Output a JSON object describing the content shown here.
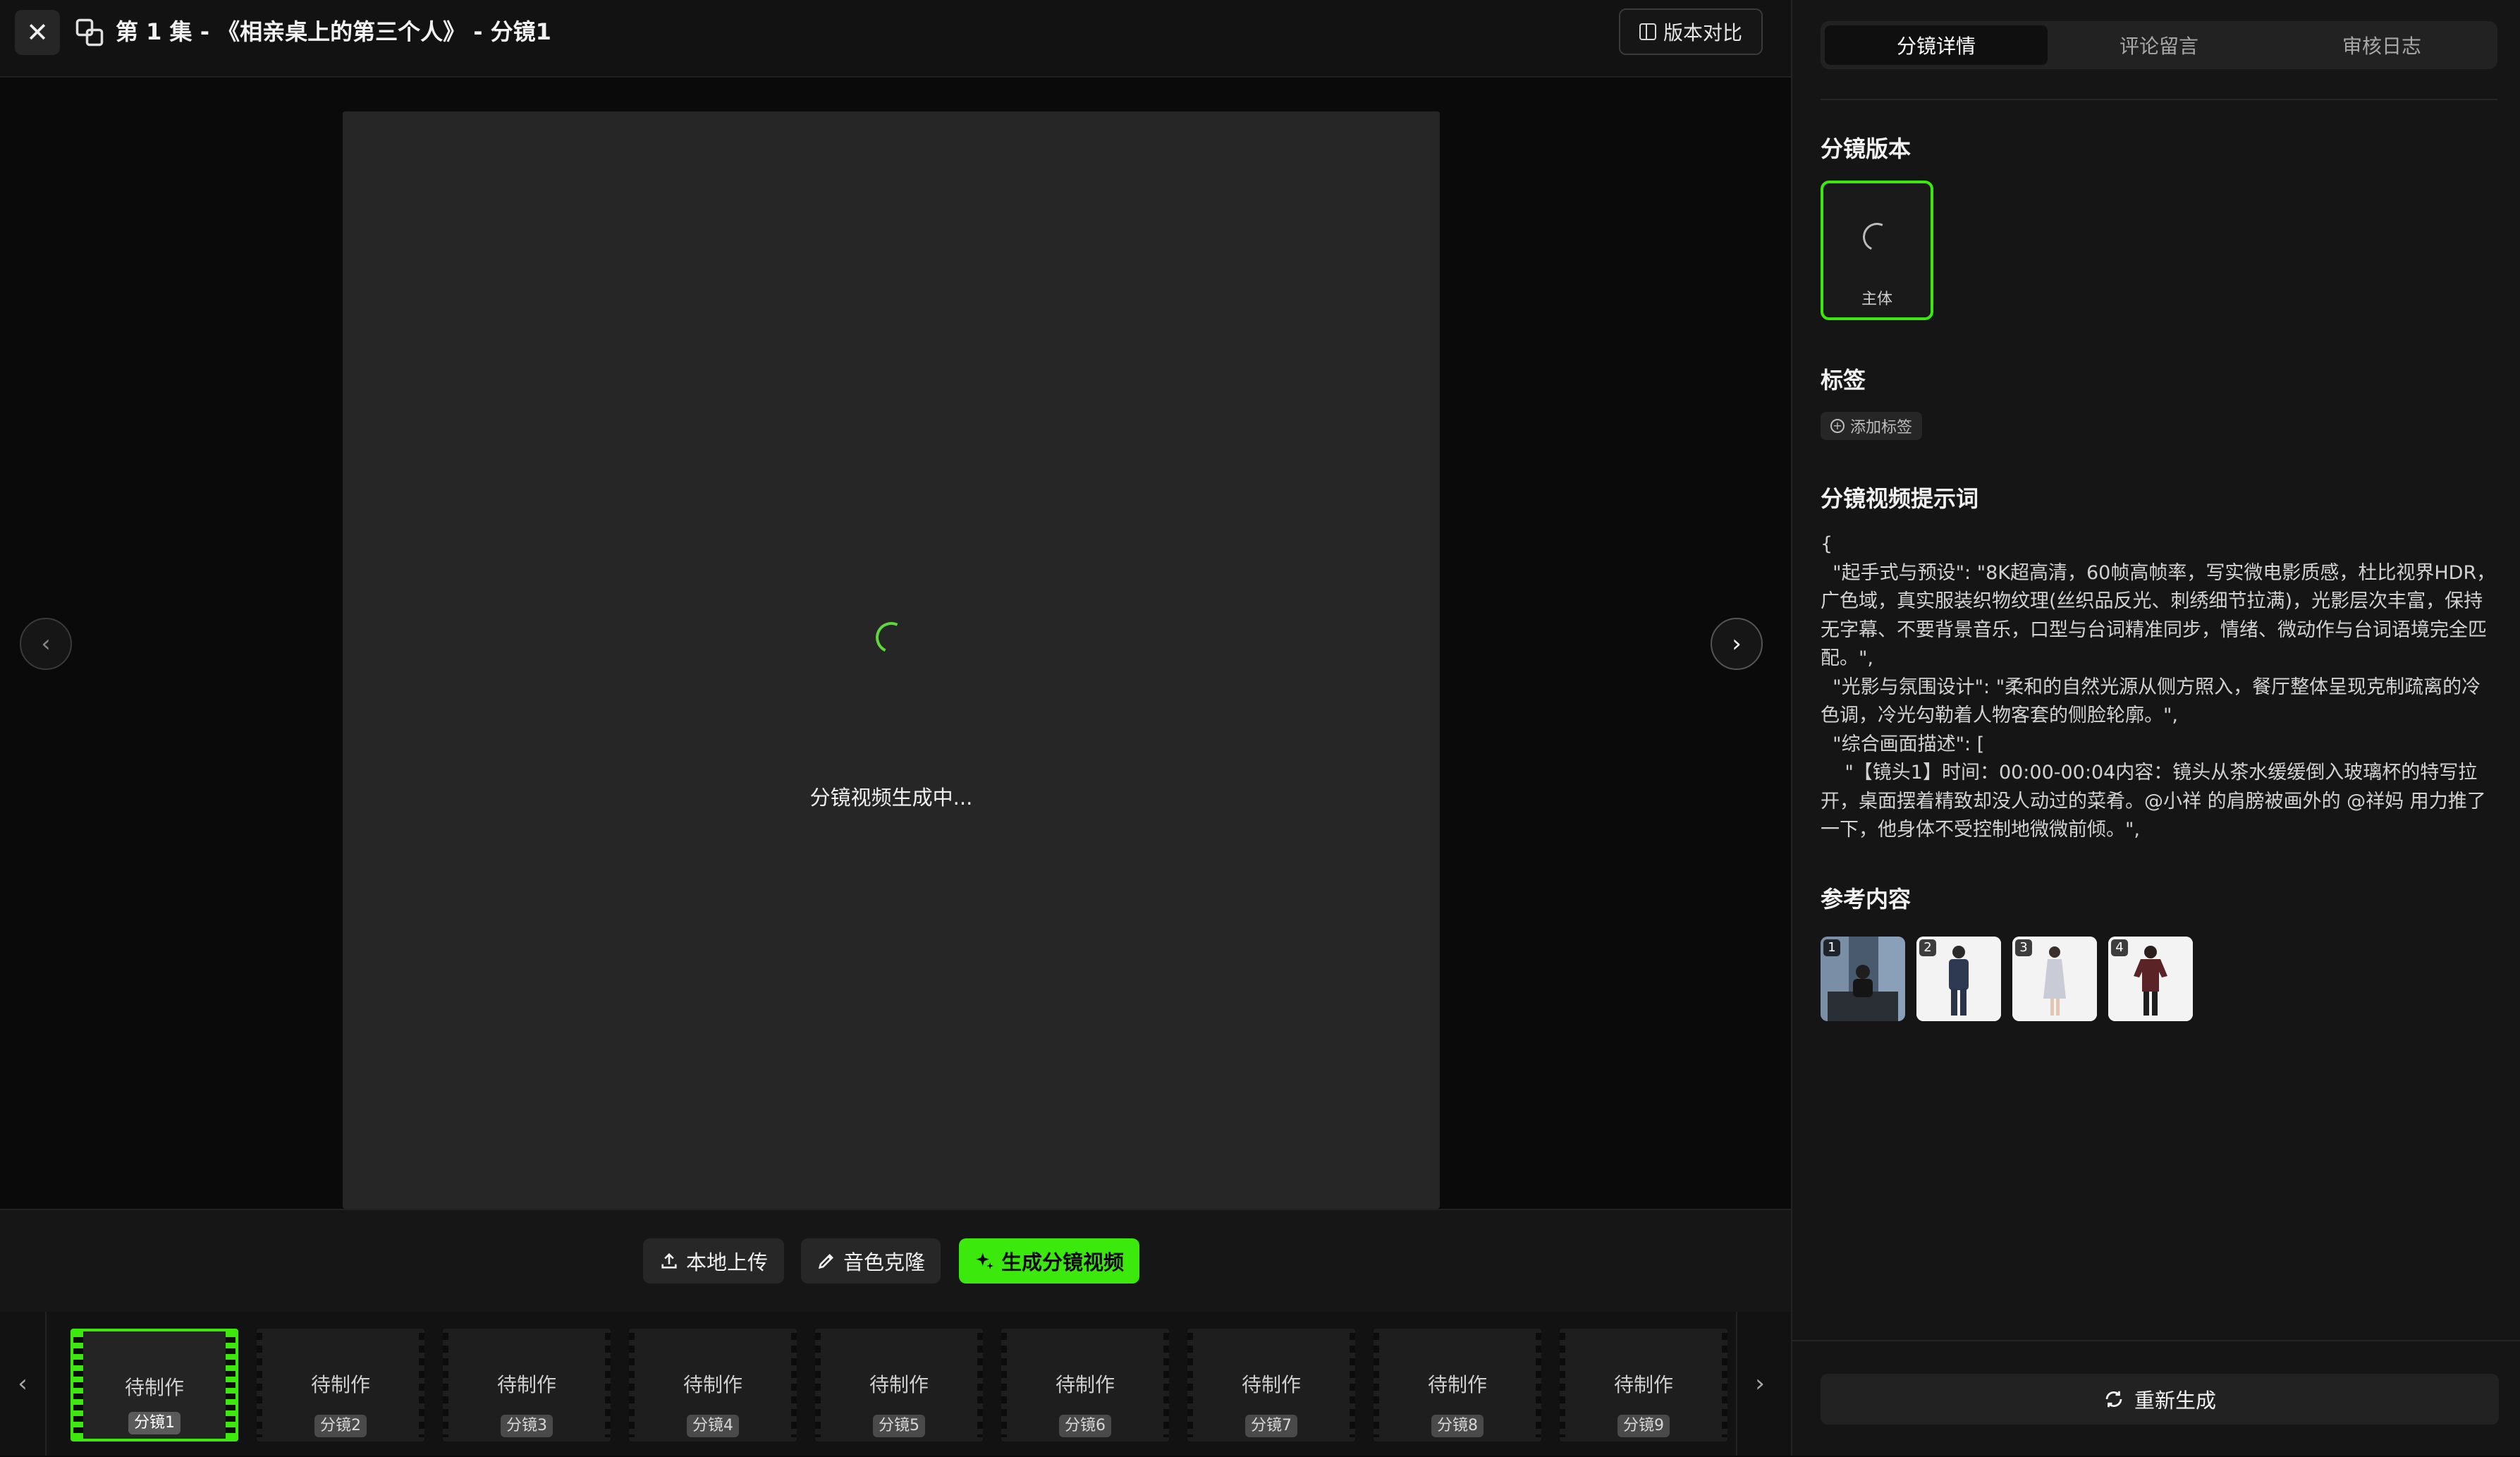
{
  "header": {
    "title": "第 1 集 - 《相亲桌上的第三个人》 - 分镜1",
    "compare_label": "版本对比"
  },
  "preview": {
    "status_text": "分镜视频生成中..."
  },
  "actions": {
    "upload_label": "本地上传",
    "voice_clone_label": "音色克隆",
    "generate_label": "生成分镜视频"
  },
  "filmstrip": {
    "frames": [
      {
        "status": "待制作",
        "label": "分镜1",
        "active": true
      },
      {
        "status": "待制作",
        "label": "分镜2"
      },
      {
        "status": "待制作",
        "label": "分镜3"
      },
      {
        "status": "待制作",
        "label": "分镜4"
      },
      {
        "status": "待制作",
        "label": "分镜5"
      },
      {
        "status": "待制作",
        "label": "分镜6"
      },
      {
        "status": "待制作",
        "label": "分镜7"
      },
      {
        "status": "待制作",
        "label": "分镜8"
      },
      {
        "status": "待制作",
        "label": "分镜9"
      }
    ]
  },
  "panel": {
    "tabs": [
      "分镜详情",
      "评论留言",
      "审核日志"
    ],
    "active_tab": 0,
    "version_title": "分镜版本",
    "version_card_label": "主体",
    "tags_title": "标签",
    "add_tag_label": "添加标签",
    "prompt_title": "分镜视频提示词",
    "prompt_text": "{\n  \"起手式与预设\": \"8K超高清，60帧高帧率，写实微电影质感，杜比视界HDR，广色域，真实服装织物纹理(丝织品反光、刺绣细节拉满)，光影层次丰富，保持无字幕、不要背景音乐，口型与台词精准同步，情绪、微动作与台词语境完全匹配。\",\n  \"光影与氛围设计\": \"柔和的自然光源从侧方照入，餐厅整体呈现克制疏离的冷色调，冷光勾勒着人物客套的侧脸轮廓。\",\n  \"综合画面描述\": [\n    \"【镜头1】时间：00:00-00:04内容：镜头从茶水缓缓倒入玻璃杯的特写拉开，桌面摆着精致却没人动过的菜肴。@小祥 的肩膀被画外的 @祥妈 用力推了一下，他身体不受控制地微微前倾。\",",
    "refs_title": "参考内容",
    "refs": [
      "1",
      "2",
      "3",
      "4"
    ],
    "regen_label": "重新生成"
  },
  "colors": {
    "accent": "#3bea0c",
    "background": "#0a0a0a",
    "panel": "#151515"
  }
}
